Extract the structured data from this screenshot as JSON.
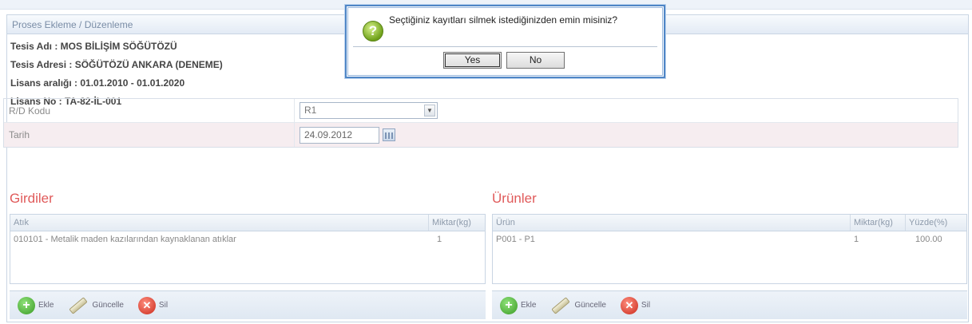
{
  "panel": {
    "title": "Proses Ekleme / Düzenleme"
  },
  "info": {
    "tesis_adi": "Tesis Adı : MOS BİLİŞİM SÖĞÜTÖZÜ",
    "tesis_adresi": "Tesis Adresi : SÖĞÜTÖZÜ ANKARA (DENEME)",
    "lisans_araligi": "Lisans aralığı : 01.01.2010 - 01.01.2020",
    "lisans_no": "Lisans No : TA-82-İL-001"
  },
  "form": {
    "rd_label": "R/D Kodu",
    "rd_value": "R1",
    "tarih_label": "Tarih",
    "tarih_value": "24.09.2012"
  },
  "girdiler": {
    "title": "Girdiler",
    "columns": [
      "Atık",
      "Miktar(kg)"
    ],
    "rows": [
      [
        "010101 - Metalik maden kazılarından kaynaklanan atıklar",
        "1"
      ]
    ],
    "toolbar": {
      "add": "Ekle",
      "edit": "Güncelle",
      "delete": "Sil"
    }
  },
  "urunler": {
    "title": "Ürünler",
    "columns": [
      "Ürün",
      "Miktar(kg)",
      "Yüzde(%)"
    ],
    "rows": [
      [
        "P001 - P1",
        "1",
        "100.00"
      ]
    ],
    "toolbar": {
      "add": "Ekle",
      "edit": "Güncelle",
      "delete": "Sil"
    }
  },
  "dialog": {
    "message": "Seçtiğiniz kayıtları silmek istediğinizden emin misiniz?",
    "yes": "Yes",
    "no": "No"
  }
}
